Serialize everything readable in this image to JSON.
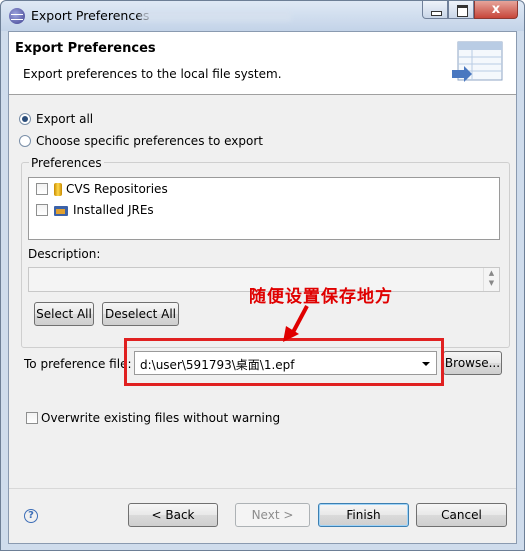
{
  "window": {
    "title": "Export Preferences",
    "close_glyph": "x"
  },
  "banner": {
    "title": "Export Preferences",
    "description": "Export preferences to the local file system."
  },
  "options": {
    "export_all": "Export all",
    "choose_specific": "Choose specific preferences to export",
    "selected": "export_all"
  },
  "preferences": {
    "group_label": "Preferences",
    "items": [
      {
        "label": "CVS Repositories",
        "icon": "cvs-repository-icon",
        "checked": false
      },
      {
        "label": "Installed JREs",
        "icon": "jre-icon",
        "checked": false
      }
    ]
  },
  "description": {
    "label": "Description:"
  },
  "buttons": {
    "select_all": "Select All",
    "deselect_all": "Deselect All",
    "browse": "Browse...",
    "back": "< Back",
    "next": "Next >",
    "finish": "Finish",
    "cancel": "Cancel"
  },
  "target": {
    "label": "To preference file:",
    "value": "d:\\user\\591793\\桌面\\1.epf"
  },
  "overwrite": {
    "label": "Overwrite existing files without warning",
    "checked": false
  },
  "annotation": {
    "text": "随便设置保存地方",
    "color": "#e00000"
  },
  "help": {
    "glyph": "?"
  }
}
